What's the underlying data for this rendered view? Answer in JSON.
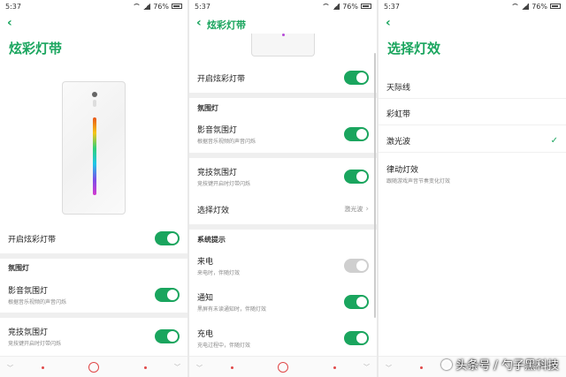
{
  "status": {
    "time": "5:37",
    "battery": "76%"
  },
  "panel1": {
    "title": "炫彩灯带",
    "toggle_row": {
      "label": "开启炫彩灯带",
      "on": true
    },
    "section": "氛围灯",
    "rows": [
      {
        "label": "影音氛围灯",
        "sub": "根据音乐视频的声音闪烁",
        "on": true
      },
      {
        "label": "竞技氛围灯",
        "sub": "竞技键开启时灯带闪烁",
        "on": true
      }
    ]
  },
  "panel2": {
    "title": "炫彩灯带",
    "toggle_row": {
      "label": "开启炫彩灯带",
      "on": true
    },
    "section1": "氛围灯",
    "rows": [
      {
        "label": "影音氛围灯",
        "sub": "根据音乐视频的声音闪烁",
        "on": true
      },
      {
        "label": "竞技氛围灯",
        "sub": "竞技键开启时灯带闪烁",
        "on": true
      }
    ],
    "effect": {
      "label": "选择灯效",
      "value": "激光波"
    },
    "section2": "系统提示",
    "system": [
      {
        "label": "来电",
        "sub": "来电时，伴随灯效",
        "on": true,
        "disabled": true
      },
      {
        "label": "通知",
        "sub": "黑屏有未读通知时，伴随灯效",
        "on": true
      },
      {
        "label": "充电",
        "sub": "充电过程中，伴随灯效",
        "on": true
      }
    ]
  },
  "panel3": {
    "title": "选择灯效",
    "options": [
      {
        "label": "天际线"
      },
      {
        "label": "彩虹带"
      },
      {
        "label": "激光波",
        "selected": true
      },
      {
        "label": "律动灯效",
        "sub": "跟随游戏声音节奏变化灯效"
      }
    ]
  },
  "watermark": "头条号 / 勺子黑科技",
  "colors": {
    "accent": "#1aa55e",
    "nav_red": "#e04848"
  },
  "icons": [
    "back-arrow-icon",
    "wifi-icon",
    "signal-icon",
    "battery-icon",
    "chevron-right-icon",
    "check-icon",
    "home-icon"
  ]
}
